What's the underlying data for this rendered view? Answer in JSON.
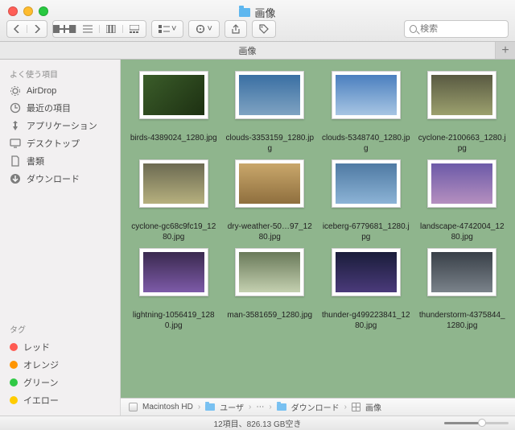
{
  "window": {
    "title": "画像"
  },
  "tabs": {
    "active": "画像",
    "add_label": "+"
  },
  "search": {
    "placeholder": "検索"
  },
  "sidebar": {
    "favorites_header": "よく使う項目",
    "favorites": [
      {
        "label": "AirDrop",
        "icon": "airdrop-icon"
      },
      {
        "label": "最近の項目",
        "icon": "recents-icon"
      },
      {
        "label": "アプリケーション",
        "icon": "applications-icon"
      },
      {
        "label": "デスクトップ",
        "icon": "desktop-icon"
      },
      {
        "label": "書類",
        "icon": "documents-icon"
      },
      {
        "label": "ダウンロード",
        "icon": "downloads-icon"
      }
    ],
    "tags_header": "タグ",
    "tags": [
      {
        "label": "レッド",
        "color": "#ff5b52"
      },
      {
        "label": "オレンジ",
        "color": "#ff9500"
      },
      {
        "label": "グリーン",
        "color": "#30c945"
      },
      {
        "label": "イエロー",
        "color": "#ffcc00"
      }
    ]
  },
  "thumb_colors": [
    "linear-gradient(135deg,#3b5d2a,#1d3012)",
    "linear-gradient(#3a6fa3,#7fa3c2)",
    "linear-gradient(#4b7fbf,#a7c5e3)",
    "linear-gradient(#595a42,#9ca06e)",
    "linear-gradient(#6c6a52,#b6b07e)",
    "linear-gradient(#c9a76b,#8f6f3e)",
    "linear-gradient(#4f7aa3,#8cb3d6)",
    "linear-gradient(#6c5aa8,#b58fbf)",
    "linear-gradient(#3a2a4f,#7d5aa8)",
    "linear-gradient(#6a7a5a,#c4d0b0)",
    "linear-gradient(#1a1d3a,#4a3a7a)",
    "linear-gradient(#394048,#7a828a)"
  ],
  "items": [
    {
      "name": "birds-4389024_1280.jpg"
    },
    {
      "name": "clouds-3353159_1280.jpg"
    },
    {
      "name": "clouds-5348740_1280.jpg"
    },
    {
      "name": "cyclone-2100663_1280.jpg"
    },
    {
      "name": "cyclone-gc68c9fc19_1280.jpg"
    },
    {
      "name": "dry-weather-50…97_1280.jpg"
    },
    {
      "name": "iceberg-6779681_1280.jpg"
    },
    {
      "name": "landscape-4742004_1280.jpg"
    },
    {
      "name": "lightning-1056419_1280.jpg"
    },
    {
      "name": "man-3581659_1280.jpg"
    },
    {
      "name": "thunder-g499223841_1280.jpg"
    },
    {
      "name": "thunderstorm-4375844_1280.jpg"
    }
  ],
  "path": {
    "segments": [
      "Macintosh HD",
      "ユーザ",
      "⋯",
      "ダウンロード",
      "画像"
    ]
  },
  "status": {
    "text": "12項目、826.13 GB空き"
  }
}
